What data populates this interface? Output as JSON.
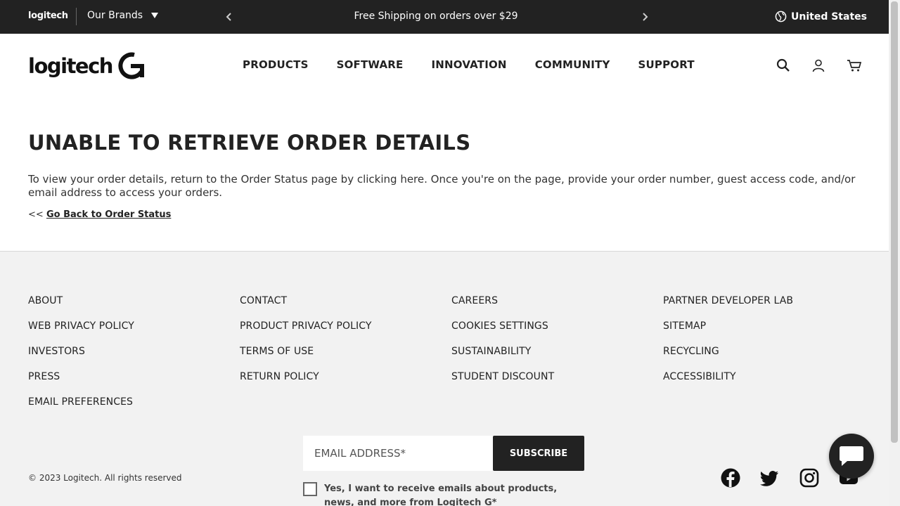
{
  "topbar": {
    "brand": "logitech",
    "brands_label": "Our Brands",
    "promo": "Free Shipping on orders over $29",
    "region": "United States"
  },
  "header": {
    "logo_text": "logitech",
    "nav": [
      "PRODUCTS",
      "SOFTWARE",
      "INNOVATION",
      "COMMUNITY",
      "SUPPORT"
    ]
  },
  "main": {
    "title": "UNABLE TO RETRIEVE ORDER DETAILS",
    "body": "To view your order details, return to the Order Status page by clicking here. Once you're on the page, provide your order number, guest access code, and/or email address to access your orders.",
    "back_prefix": "<<",
    "back_link": "Go Back to Order Status"
  },
  "footer": {
    "col1": [
      "ABOUT",
      "WEB PRIVACY POLICY",
      "INVESTORS",
      "PRESS",
      "EMAIL PREFERENCES"
    ],
    "col2": [
      "CONTACT",
      "PRODUCT PRIVACY POLICY",
      "TERMS OF USE",
      "RETURN POLICY"
    ],
    "col3": [
      "CAREERS",
      "COOKIES SETTINGS",
      "SUSTAINABILITY",
      "STUDENT DISCOUNT"
    ],
    "col4": [
      "PARTNER DEVELOPER LAB",
      "SITEMAP",
      "RECYCLING",
      "ACCESSIBILITY"
    ],
    "copyright": "© 2023 Logitech. All rights reserved",
    "email_placeholder": "EMAIL ADDRESS*",
    "subscribe_label": "SUBSCRIBE",
    "optin_text": "Yes, I want to receive emails about products, news, and more from Logitech G*",
    "social_icons": [
      "facebook-icon",
      "twitter-icon",
      "instagram-icon",
      "youtube-icon"
    ]
  },
  "colors": {
    "dark": "#222222",
    "footer_bg": "#f2f2f2"
  }
}
